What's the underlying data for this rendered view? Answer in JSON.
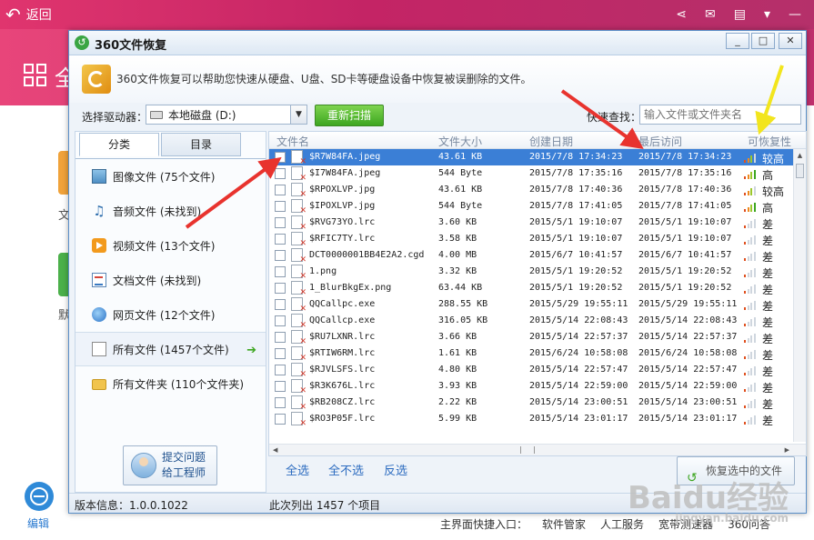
{
  "background": {
    "back_label": "返回",
    "quan": "全",
    "side_labels": [
      "文",
      "默"
    ],
    "edit_label": "编辑",
    "bottom_links": [
      "主界面快捷入口：",
      "软件管家",
      "人工服务",
      "宽带测速器",
      "360问答"
    ]
  },
  "dialog": {
    "title": "360文件恢复",
    "info_text": "360文件恢复可以帮助您快速从硬盘、U盘、SD卡等硬盘设备中恢复被误删除的文件。",
    "drive_label": "选择驱动器：",
    "drive_value": "本地磁盘 (D:)",
    "scan_button": "重新扫描",
    "quick_search_label": "快速查找：",
    "quick_search_placeholder": "输入文件或文件夹名",
    "tabs": [
      "分类",
      "目录"
    ],
    "categories": [
      {
        "label": "图像文件 (75个文件)",
        "icon": "image-icon"
      },
      {
        "label": "音频文件 (未找到)",
        "icon": "audio-icon"
      },
      {
        "label": "视频文件 (13个文件)",
        "icon": "video-icon"
      },
      {
        "label": "文档文件 (未找到)",
        "icon": "document-icon"
      },
      {
        "label": "网页文件 (12个文件)",
        "icon": "web-icon"
      },
      {
        "label": "所有文件 (1457个文件)",
        "icon": "all-files-icon"
      },
      {
        "label": "所有文件夹 (110个文件夹)",
        "icon": "folder-icon"
      }
    ],
    "help_line1": "提交问题",
    "help_line2": "给工程师",
    "columns": [
      "文件名",
      "文件大小",
      "创建日期",
      "最后访问",
      "可恢复性"
    ],
    "files": [
      {
        "name": "$R7W84FA.jpeg",
        "size": "43.61 KB",
        "created": "2015/7/8 17:34:23",
        "accessed": "2015/7/8 17:34:23",
        "rate": "较高",
        "level": 3
      },
      {
        "name": "$I7W84FA.jpeg",
        "size": "544 Byte",
        "created": "2015/7/8 17:35:16",
        "accessed": "2015/7/8 17:35:16",
        "rate": "高",
        "level": 4
      },
      {
        "name": "$RPOXLVP.jpg",
        "size": "43.61 KB",
        "created": "2015/7/8 17:40:36",
        "accessed": "2015/7/8 17:40:36",
        "rate": "较高",
        "level": 3
      },
      {
        "name": "$IPOXLVP.jpg",
        "size": "544 Byte",
        "created": "2015/7/8 17:41:05",
        "accessed": "2015/7/8 17:41:05",
        "rate": "高",
        "level": 4
      },
      {
        "name": "$RVG73YO.lrc",
        "size": "3.60 KB",
        "created": "2015/5/1 19:10:07",
        "accessed": "2015/5/1 19:10:07",
        "rate": "差",
        "level": 1
      },
      {
        "name": "$RFIC7TY.lrc",
        "size": "3.58 KB",
        "created": "2015/5/1 19:10:07",
        "accessed": "2015/5/1 19:10:07",
        "rate": "差",
        "level": 1
      },
      {
        "name": "DCT0000001BB4E2A2.cgd",
        "size": "4.00 MB",
        "created": "2015/6/7 10:41:57",
        "accessed": "2015/6/7 10:41:57",
        "rate": "差",
        "level": 1
      },
      {
        "name": "1.png",
        "size": "3.32 KB",
        "created": "2015/5/1 19:20:52",
        "accessed": "2015/5/1 19:20:52",
        "rate": "差",
        "level": 1
      },
      {
        "name": "1_BlurBkgEx.png",
        "size": "63.44 KB",
        "created": "2015/5/1 19:20:52",
        "accessed": "2015/5/1 19:20:52",
        "rate": "差",
        "level": 1
      },
      {
        "name": "QQCallpc.exe",
        "size": "288.55 KB",
        "created": "2015/5/29 19:55:11",
        "accessed": "2015/5/29 19:55:11",
        "rate": "差",
        "level": 1
      },
      {
        "name": "QQCallcp.exe",
        "size": "316.05 KB",
        "created": "2015/5/14 22:08:43",
        "accessed": "2015/5/14 22:08:43",
        "rate": "差",
        "level": 1
      },
      {
        "name": "$RU7LXNR.lrc",
        "size": "3.66 KB",
        "created": "2015/5/14 22:57:37",
        "accessed": "2015/5/14 22:57:37",
        "rate": "差",
        "level": 1
      },
      {
        "name": "$RTIW6RM.lrc",
        "size": "1.61 KB",
        "created": "2015/6/24 10:58:08",
        "accessed": "2015/6/24 10:58:08",
        "rate": "差",
        "level": 1
      },
      {
        "name": "$RJVLSFS.lrc",
        "size": "4.80 KB",
        "created": "2015/5/14 22:57:47",
        "accessed": "2015/5/14 22:57:47",
        "rate": "差",
        "level": 1
      },
      {
        "name": "$R3K676L.lrc",
        "size": "3.93 KB",
        "created": "2015/5/14 22:59:00",
        "accessed": "2015/5/14 22:59:00",
        "rate": "差",
        "level": 1
      },
      {
        "name": "$RB208CZ.lrc",
        "size": "2.22 KB",
        "created": "2015/5/14 23:00:51",
        "accessed": "2015/5/14 23:00:51",
        "rate": "差",
        "level": 1
      },
      {
        "name": "$RO3P05F.lrc",
        "size": "5.99 KB",
        "created": "2015/5/14 23:01:17",
        "accessed": "2015/5/14 23:01:17",
        "rate": "差",
        "level": 1
      }
    ],
    "select_all": "全选",
    "select_none": "全不选",
    "select_invert": "反选",
    "recover_button": "恢复选中的文件",
    "version_info": "版本信息：1.0.0.1022",
    "list_count": "此次列出 1457 个项目"
  },
  "watermark": {
    "text": "Baidu经验",
    "sub": "jingyan.baidu.com"
  }
}
